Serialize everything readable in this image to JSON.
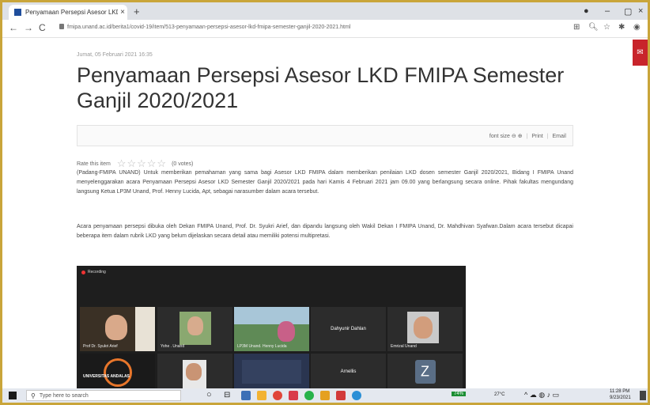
{
  "browser": {
    "tab_title": "Penyamaan Persepsi Asesor LKD",
    "tab_close": "×",
    "new_tab": "+",
    "url": "fmipa.unand.ac.id/berita1/covid-19/item/513-penyamaan-persepsi-asesor-lkd-fmipa-semester-ganjil-2020-2021.html",
    "back": "←",
    "forward": "→",
    "reload": "C",
    "minimize": "–",
    "maximize": "▢",
    "close": "×"
  },
  "side_tab_symbol": "✉",
  "article": {
    "date": "Jumat, 05 Februari 2021 16:35",
    "title": "Penyamaan Persepsi Asesor LKD FMIPA Semester Ganjil 2020/2021",
    "tools": {
      "font_size": "font size",
      "print": "Print",
      "email": "Email"
    },
    "rate_label": "Rate this item",
    "rate_stars": "☆☆☆☆☆",
    "rate_votes": "(0 votes)",
    "paragraph1": "(Padang-FMIPA UNAND) Untuk memberikan pemahaman yang sama bagi Asesor LKD FMIPA dalam memberikan penilaian LKD dosen semester Ganjil 2020/2021, Bidang I FMIPA Unand menyelenggarakan acara Penyamaan Persepsi Asesor LKD Semester Ganjil 2020/2021 pada hari Kamis 4 Februari 2021 jam 09.00 yang berlangsung secara online. Pihak fakultas mengundang langsung Ketua LP3M Unand, Prof. Henny Lucida, Apt, sebagai narasumber dalam acara tersebut.",
    "paragraph2": "Acara penyamaan persepsi dibuka oleh Dekan FMIPA Unand, Prof. Dr. Syukri Arief, dan dipandu langsung oleh Wakil Dekan I FMIPA Unand, Dr. Mahdhivan Syafwan.Dalam acara tersebut dicapai beberapa item dalam rubrik LKD yang belum dijelaskan secara detail atau memiliki potensi multipretasi."
  },
  "video": {
    "recording": "Recording",
    "tiles": [
      {
        "name": "Prof Dr. Syukri Arief"
      },
      {
        "name": "Yohe . Unand"
      },
      {
        "name": "LP3M Unand. Henny Lucida"
      },
      {
        "center": "Dahyunir Dahlan"
      },
      {
        "name": "Emrizal Unand"
      },
      {
        "banner": "UNIVERSITAS ANDALAS"
      },
      {
        "name": ""
      },
      {
        "name": ""
      },
      {
        "center": "Arnellis"
      },
      {
        "center": "Z"
      }
    ]
  },
  "taskbar": {
    "search_placeholder": "Type here to search",
    "battery": "74%",
    "weather": "27°C",
    "time": "11:28 PM",
    "date": "9/23/2021"
  },
  "colors": {
    "frame": "#c9a53a",
    "side_tab": "#c8242b",
    "video_bg": "#1e1e1e"
  }
}
